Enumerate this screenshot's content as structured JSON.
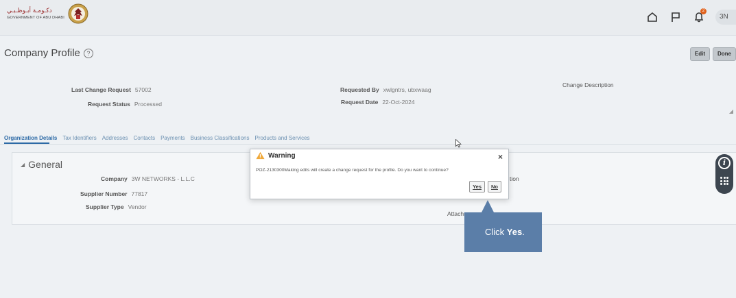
{
  "header": {
    "logo_ar": "دكـومـة أبـوظـبـي",
    "logo_en": "GOVERNMENT OF ABU DHABI",
    "notification_count": "2",
    "user_initials": "3N"
  },
  "page": {
    "title": "Company Profile",
    "help_glyph": "?",
    "edit_label": "Edit",
    "done_label": "Done"
  },
  "request": {
    "last_change_label": "Last Change Request",
    "last_change_value": "57002",
    "status_label": "Request Status",
    "status_value": "Processed",
    "requested_by_label": "Requested By",
    "requested_by_value": "xwlgntrs, ubxwaag",
    "request_date_label": "Request Date",
    "request_date_value": "22-Oct-2024",
    "change_description_label": "Change Description"
  },
  "tabs": [
    "Organization Details",
    "Tax Identifiers",
    "Addresses",
    "Contacts",
    "Payments",
    "Business Classifications",
    "Products and Services"
  ],
  "general": {
    "title": "General",
    "company_label": "Company",
    "company_value": "3W NETWORKS - L.L.C",
    "supplier_number_label": "Supplier Number",
    "supplier_number_value": "77817",
    "supplier_type_label": "Supplier Type",
    "supplier_type_value": "Vendor",
    "partial_label": "tion",
    "attachments_label": "Attachm"
  },
  "dialog": {
    "title": "Warning",
    "message": "POZ-2130300Making edits will create a change request for the profile. Do you want to continue?",
    "yes_label": "Yes",
    "no_label": "No",
    "close_glyph": "×"
  },
  "callout": {
    "prefix": "Click ",
    "bold": "Yes",
    "suffix": "."
  },
  "colors": {
    "accent": "#2d6aa6",
    "callout": "#5b7ea8",
    "warning": "#f0a93b",
    "notification": "#e0611c"
  }
}
